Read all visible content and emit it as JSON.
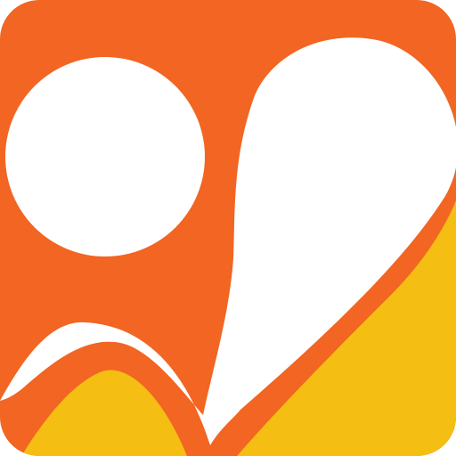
{
  "icon": {
    "name": "app-logo-icon",
    "colors": {
      "primary": "#F26522",
      "secondary": "#F5BE12",
      "shape": "#FFFFFF"
    }
  }
}
